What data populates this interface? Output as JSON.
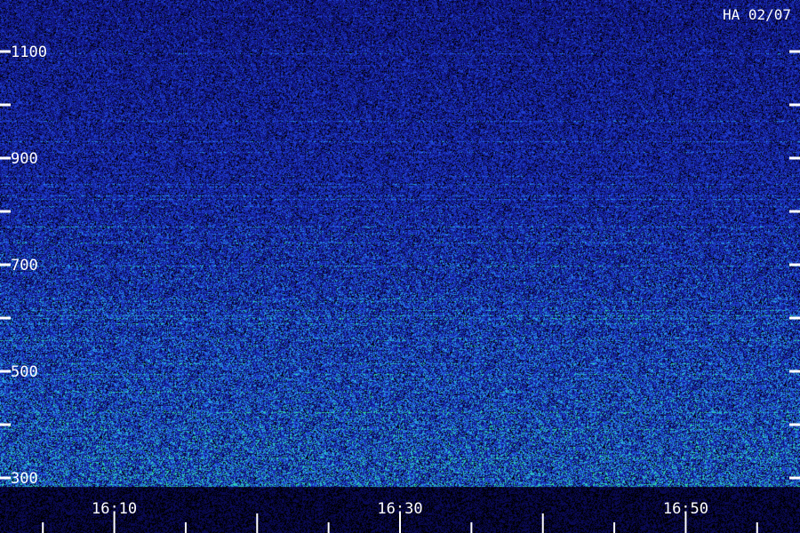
{
  "station_label": "HA 02/07",
  "colors": {
    "background": "#000000",
    "noise_dark": "#101580",
    "noise_mid": "#1f3fd0",
    "noise_cyan": "#29a0e6",
    "noise_green": "#2de0a0",
    "axis_white": "#ffffff",
    "footer_band": "#0a0a55"
  },
  "chart_data": {
    "type": "heatmap",
    "title": "HA 02/07",
    "xlabel": "",
    "ylabel": "",
    "grid": false,
    "y_axis": {
      "min": 300,
      "max": 1100,
      "tick_labels": [
        {
          "value": 1100,
          "text": "1100"
        },
        {
          "value": 900,
          "text": "900"
        },
        {
          "value": 700,
          "text": "700"
        },
        {
          "value": 500,
          "text": "500"
        },
        {
          "value": 300,
          "text": "300"
        }
      ],
      "minor_ticks": [
        1000,
        800,
        600,
        400
      ]
    },
    "x_axis": {
      "labels": [
        {
          "value": "16:10",
          "text": "16:10"
        },
        {
          "value": "16:30",
          "text": "16:30"
        },
        {
          "value": "16:50",
          "text": "16:50"
        }
      ],
      "major_ticks": [
        "16:10",
        "16:20",
        "16:30",
        "16:40",
        "16:50"
      ],
      "minor_ticks": [
        "16:05",
        "16:15",
        "16:25",
        "16:35",
        "16:45",
        "16:55"
      ],
      "range": [
        "16:02",
        "16:58"
      ]
    }
  }
}
